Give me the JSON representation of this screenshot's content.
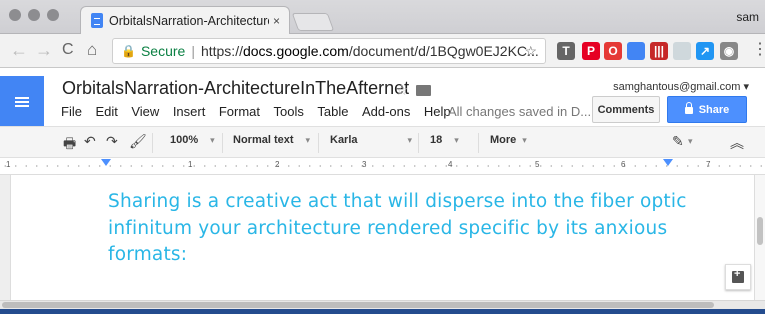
{
  "browser": {
    "tab_title": "OrbitalsNarration-Architecture",
    "tab_close": "×",
    "profile_name": "sam",
    "secure_label": "Secure",
    "url_scheme": "https://",
    "url_domain": "docs.google.com",
    "url_path": "/document/d/1BQgw0EJ2KC...",
    "nav": {
      "back": "←",
      "forward": "→",
      "reload": "C",
      "home": "⌂"
    },
    "bookmark_star": "☆",
    "extensions": [
      {
        "icon": "t-icon",
        "glyph": "T",
        "color": "#666666"
      },
      {
        "icon": "pinterest-icon",
        "glyph": "P",
        "color": "#e60023"
      },
      {
        "icon": "opera-icon",
        "glyph": "O",
        "color": "#e53935"
      },
      {
        "icon": "docs-icon",
        "glyph": "",
        "color": "#4285f4"
      },
      {
        "icon": "bars-icon",
        "glyph": "|||",
        "color": "#c62828"
      },
      {
        "icon": "cloud-icon",
        "glyph": "",
        "color": "#cfd8dc"
      },
      {
        "icon": "arrow-icon",
        "glyph": "↗",
        "color": "#2196f3"
      },
      {
        "icon": "camera-icon",
        "glyph": "◉",
        "color": "#888888"
      }
    ],
    "menu_dots": "⋮"
  },
  "docs": {
    "title": "OrbitalsNarration-ArchitectureInTheAfternet",
    "menus": [
      "File",
      "Edit",
      "View",
      "Insert",
      "Format",
      "Tools",
      "Table",
      "Add-ons",
      "Help"
    ],
    "save_status": "All changes saved in D...",
    "account": "samghantous@gmail.com",
    "comments_label": "Comments",
    "share_label": "Share"
  },
  "toolbar": {
    "zoom": "100%",
    "style": "Normal text",
    "font": "Karla",
    "size": "18",
    "more": "More",
    "dropdown_glyph": "▾",
    "collapse_glyph": "︽"
  },
  "ruler": {
    "numbers": [
      "1",
      "1",
      "2",
      "3",
      "4",
      "5",
      "6",
      "7"
    ]
  },
  "content": {
    "body_text": "Sharing is a creative act that will disperse into the fiber optic infinitum your architecture rendered specific by its anxious formats:"
  },
  "colors": {
    "accent": "#4d90fe",
    "body_text": "#29b6e6",
    "docs_blue": "#4285f4"
  }
}
